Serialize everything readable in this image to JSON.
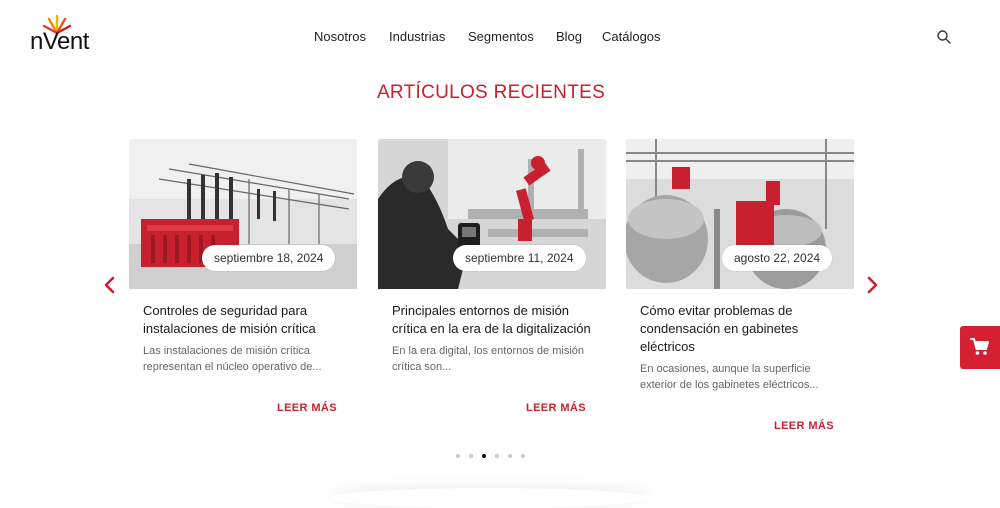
{
  "brand": {
    "logo_text": "nVent",
    "accent": "#c8202f"
  },
  "nav": {
    "items": [
      "Nosotros",
      "Industrias",
      "Segmentos",
      "Blog",
      "Catálogos"
    ]
  },
  "icons": {
    "search": "search-icon",
    "prev": "chevron-left-icon",
    "next": "chevron-right-icon",
    "cart": "shopping-cart-icon"
  },
  "section": {
    "title": "ARTÍCULOS RECIENTES"
  },
  "articles": [
    {
      "date": "septiembre 18, 2024",
      "title": "Controles de seguridad para instalaciones de misión crítica",
      "excerpt": "Las instalaciones de misión crítica representan el núcleo operativo de...",
      "link": "LEER MÁS"
    },
    {
      "date": "septiembre 11, 2024",
      "title": "Principales entornos de misión crítica en la era de la digitalización",
      "excerpt": "En la era digital, los entornos de misión crítica son...",
      "link": "LEER MÁS"
    },
    {
      "date": "agosto 22, 2024",
      "title": "Cómo evitar problemas de condensación en gabinetes eléctricos",
      "excerpt": "En ocasiones, aunque la superficie exterior de los gabinetes eléctricos...",
      "link": "LEER MÁS"
    }
  ],
  "carousel": {
    "dot_count": 6,
    "active_dot_number": 3
  }
}
